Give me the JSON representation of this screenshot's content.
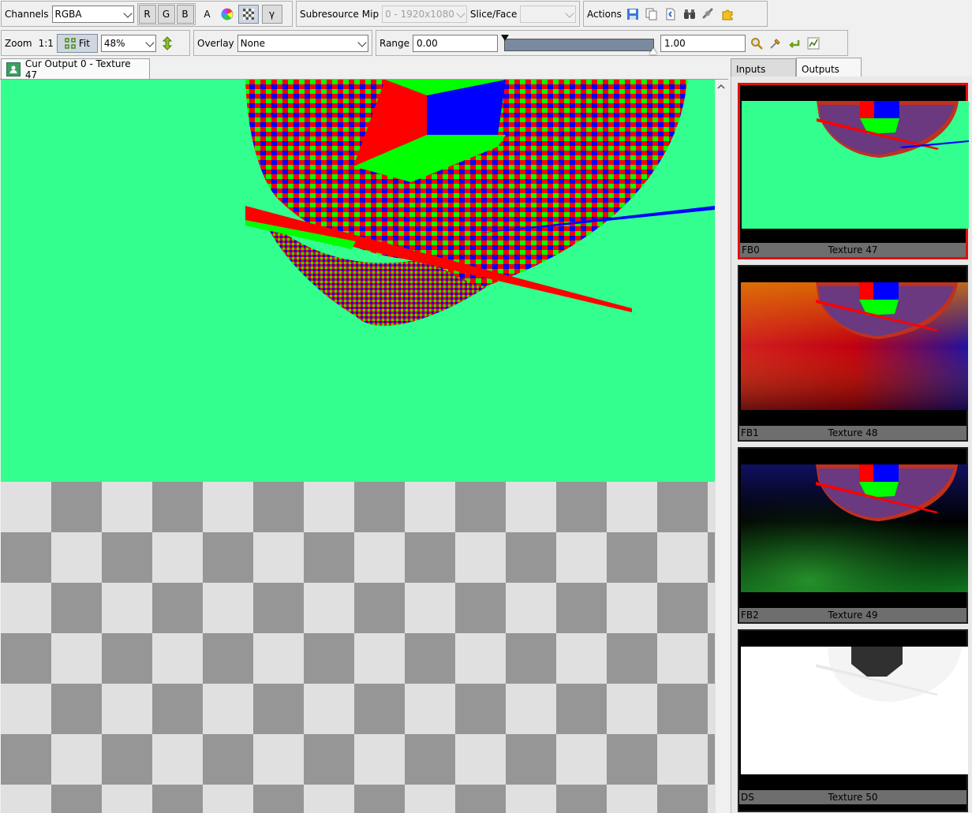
{
  "toolbar": {
    "channels": {
      "label": "Channels",
      "value": "RGBA"
    },
    "channel_buttons": [
      "R",
      "G",
      "B"
    ],
    "alpha_label": "A",
    "gamma_label": "γ",
    "subresource": {
      "label": "Subresource",
      "mip_label": "Mip",
      "mip_value": "0 - 1920x1080",
      "slice_label": "Slice/Face",
      "slice_value": ""
    },
    "actions_label": "Actions",
    "zoom": {
      "label": "Zoom",
      "one_to_one": "1:1",
      "fit_label": "Fit",
      "value": "48%"
    },
    "overlay": {
      "label": "Overlay",
      "value": "None"
    },
    "range": {
      "label": "Range",
      "min": "0.00",
      "max": "1.00"
    }
  },
  "main_tab": {
    "label": "Cur Output 0 - Texture 47"
  },
  "side_tabs": [
    "Inputs",
    "Outputs"
  ],
  "thumbnails": [
    {
      "id": "FB0",
      "name": "Texture 47",
      "selected": true
    },
    {
      "id": "FB1",
      "name": "Texture 48",
      "selected": false
    },
    {
      "id": "FB2",
      "name": "Texture 49",
      "selected": false
    },
    {
      "id": "DS",
      "name": "Texture 50",
      "selected": false
    }
  ],
  "colors": {
    "clear": "#33ff8f",
    "red": "#ff0000",
    "green": "#00ff00",
    "blue": "#0000ff",
    "selection": "#e01010"
  }
}
